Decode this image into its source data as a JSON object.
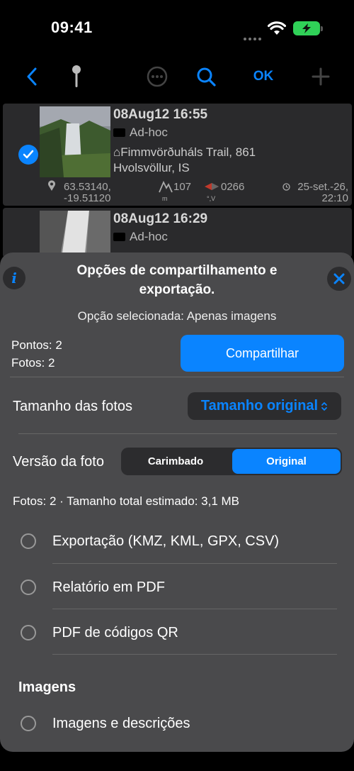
{
  "status_bar": {
    "time": "09:41"
  },
  "nav": {
    "ok_label": "OK"
  },
  "list": [
    {
      "title": "08Aug12 16:55",
      "folder": "Ad-hoc",
      "address": "⌂Fimmvörðuháls Trail, 861 Hvolsvöllur, IS",
      "coords_line1": "63.53140,",
      "coords_line2": "-19.51120",
      "altitude": "107",
      "altitude_unit": "m",
      "heading": "0266",
      "heading_unit": "°,V",
      "date_line1": "25-set.-26,",
      "date_line2": "22:10"
    },
    {
      "title": "08Aug12 16:29",
      "folder": "Ad-hoc"
    }
  ],
  "sheet": {
    "title": "Opções de compartilhamento e exportação.",
    "selected_option": "Opção selecionada: Apenas imagens",
    "points": "Pontos: 2",
    "photos": "Fotos: 2",
    "share_label": "Compartilhar",
    "photo_size_label": "Tamanho das fotos",
    "photo_size_value": "Tamanho original",
    "photo_version_label": "Versão da foto",
    "version_options": [
      "Carimbado",
      "Original"
    ],
    "version_selected": "Original",
    "estimate": "Fotos: 2 · Tamanho total estimado: 3,1 MB",
    "options": [
      {
        "label": "Exportação (KMZ, KML, GPX, CSV)"
      },
      {
        "label": "Relatório em PDF"
      },
      {
        "label": "PDF de códigos QR"
      }
    ],
    "images_section": "Imagens",
    "image_options": [
      {
        "label": "Imagens e descrições"
      }
    ]
  },
  "colors": {
    "accent": "#0a84ff",
    "sheet_bg": "#4a4a4c",
    "battery": "#30d158"
  }
}
